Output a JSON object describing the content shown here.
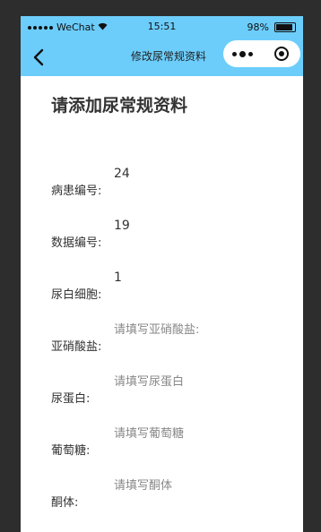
{
  "status": {
    "carrier": "WeChat",
    "time": "15:51",
    "battery": "98%"
  },
  "nav": {
    "title": "修改尿常规资料"
  },
  "page": {
    "heading": "请添加尿常规资料"
  },
  "form": {
    "fields": [
      {
        "label": "病患编号:",
        "value": "24",
        "placeholder": ""
      },
      {
        "label": "数据编号:",
        "value": "19",
        "placeholder": ""
      },
      {
        "label": "尿白细胞:",
        "value": "1",
        "placeholder": ""
      },
      {
        "label": "亚硝酸盐:",
        "value": "",
        "placeholder": "请填写亚硝酸盐:"
      },
      {
        "label": "尿蛋白:",
        "value": "",
        "placeholder": "请填写尿蛋白"
      },
      {
        "label": "葡萄糖:",
        "value": "",
        "placeholder": "请填写葡萄糖"
      },
      {
        "label": "酮体:",
        "value": "",
        "placeholder": "请填写酮体"
      }
    ]
  }
}
